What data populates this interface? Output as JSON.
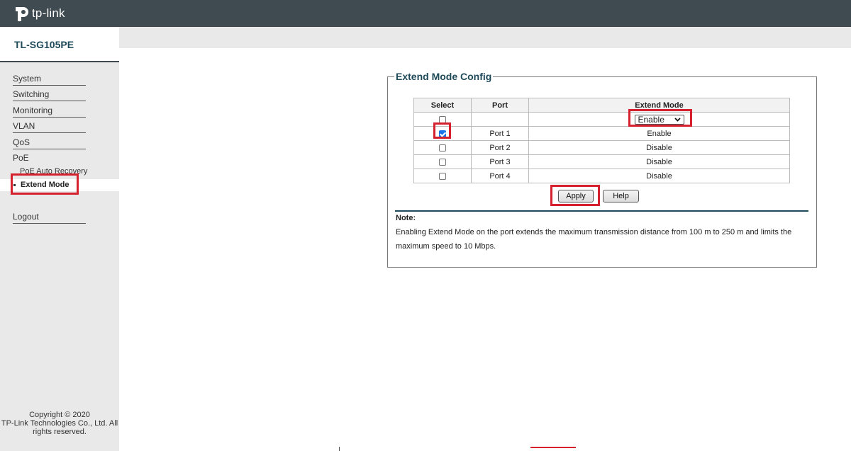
{
  "brand": {
    "logo_text": "tp-link",
    "accent": "#d5202d",
    "header_bg": "#3f4a51"
  },
  "model": "TL-SG105PE",
  "sidebar": {
    "items": [
      {
        "label": "System"
      },
      {
        "label": "Switching"
      },
      {
        "label": "Monitoring"
      },
      {
        "label": "VLAN"
      },
      {
        "label": "QoS"
      },
      {
        "label": "PoE"
      }
    ],
    "poe_sub": {
      "label": "PoE Auto Recovery"
    },
    "active": {
      "label": "Extend Mode"
    },
    "logout": "Logout"
  },
  "copyright": {
    "line1": "Copyright © 2020",
    "line2": "TP-Link Technologies Co., Ltd. All",
    "line3": "rights reserved."
  },
  "config": {
    "title": "Extend Mode Config",
    "headers": {
      "select": "Select",
      "port": "Port",
      "mode": "Extend Mode"
    },
    "global_mode": "Enable",
    "rows": [
      {
        "port": "Port 1",
        "mode": "Enable",
        "checked": true
      },
      {
        "port": "Port 2",
        "mode": "Disable",
        "checked": false
      },
      {
        "port": "Port 3",
        "mode": "Disable",
        "checked": false
      },
      {
        "port": "Port 4",
        "mode": "Disable",
        "checked": false
      }
    ],
    "apply_label": "Apply",
    "help_label": "Help"
  },
  "note": {
    "title": "Note:",
    "text": "Enabling Extend Mode on the port extends the maximum transmission distance from 100 m to 250 m and limits the maximum speed to 10 Mbps."
  }
}
